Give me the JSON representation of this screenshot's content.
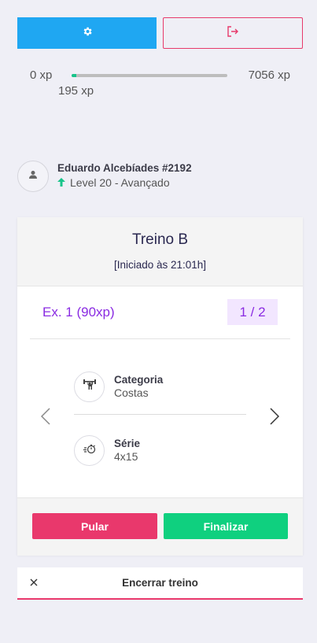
{
  "header": {
    "settings_icon": "gear-icon",
    "logout_icon": "logout-icon",
    "colors": {
      "settings_bg": "#1fa7f2",
      "logout_border": "#e73a6b"
    }
  },
  "xp": {
    "min_label": "0 xp",
    "max_label": "7056 xp",
    "current_label": "195 xp",
    "progress_fraction": 0.028
  },
  "user": {
    "name": "Eduardo Alcebíades #2192",
    "level": "Level 20 - Avançado",
    "avatar_icon": "person-icon",
    "level_icon": "arrow-up-icon"
  },
  "workout": {
    "title": "Treino B",
    "subtitle": "[Iniciado às 21:01h]",
    "exercise_label": "Ex. 1 (90xp)",
    "exercise_counter": "1 / 2",
    "category_title": "Categoria",
    "category_value": "Costas",
    "series_title": "Série",
    "series_value": "4x15",
    "skip_label": "Pular",
    "finish_label": "Finalizar"
  },
  "footer": {
    "end_label": "Encerrar treino",
    "close_icon": "close-icon"
  }
}
